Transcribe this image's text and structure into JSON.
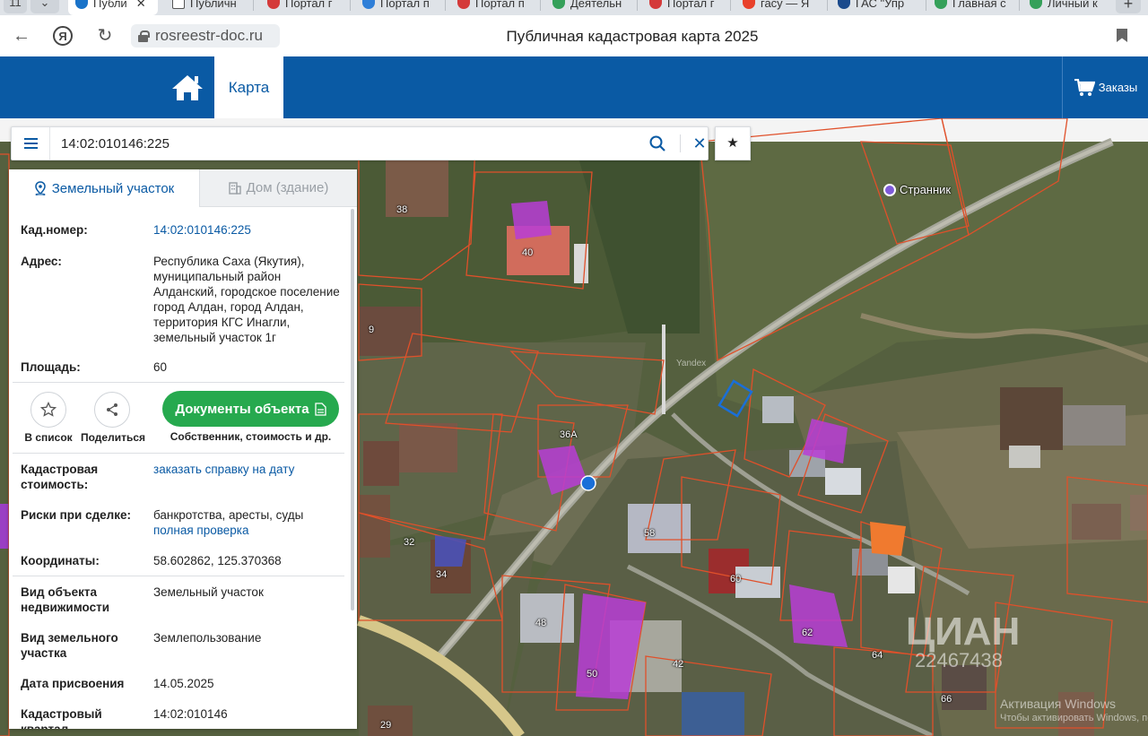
{
  "browser": {
    "tab_count_badge": "11",
    "tabs": [
      {
        "label": "Публи",
        "active": true,
        "color": "#1a73c9"
      },
      {
        "label": "Публичн",
        "color": "#555555"
      },
      {
        "label": "Портал г",
        "color": "#d43a3a"
      },
      {
        "label": "Портал п",
        "color": "#2f7fd8"
      },
      {
        "label": "Портал п",
        "color": "#d43a3a"
      },
      {
        "label": "Деятельн",
        "color": "#35a05a"
      },
      {
        "label": "Портал г",
        "color": "#d43a3a"
      },
      {
        "label": "гасу — Я",
        "color": "#e8412b"
      },
      {
        "label": "ГАС \"Упр",
        "color": "#1b4a8c"
      },
      {
        "label": "Главная с",
        "color": "#35a05a"
      },
      {
        "label": "Личный к",
        "color": "#35a05a"
      }
    ],
    "tab_close": "✕",
    "new_tab": "+",
    "url": "rosreestr-doc.ru",
    "page_title": "Публичная кадастровая карта 2025"
  },
  "header": {
    "map_tab": "Карта",
    "orders": "Заказы",
    "brand_color": "#0a5aa4"
  },
  "search": {
    "value": "14:02:010146:225",
    "clear": "✕",
    "favorite": "★"
  },
  "panel": {
    "tabs": [
      {
        "label": "Земельный участок",
        "active": true
      },
      {
        "label": "Дом (здание)",
        "active": false
      }
    ],
    "cad_number_label": "Кад.номер:",
    "cad_number_value": "14:02:010146:225",
    "address_label": "Адрес:",
    "address_value": "Республика Саха (Якутия), муниципальный район Алданский, городское поселение город Алдан, город Алдан, территория КГС Инагли, земельный участок 1г",
    "area_label": "Площадь:",
    "area_value": "60",
    "actions": {
      "to_list": "В список",
      "share": "Поделиться",
      "documents": "Документы объекта",
      "documents_sub": "Собственник, стоимость и др."
    },
    "cad_cost_label": "Кадастровая стоимость:",
    "cad_cost_value": "заказать справку на дату",
    "risks_label": "Риски при сделке:",
    "risks_value": "банкротства, аресты, суды",
    "risks_link": "полная проверка",
    "coords_label": "Координаты:",
    "coords_value": "58.602862, 125.370368",
    "object_type_label": "Вид объекта недвижимости",
    "object_type_value": "Земельный участок",
    "land_type_label": "Вид земельного участка",
    "land_type_value": "Землепользование",
    "assign_date_label": "Дата присвоения",
    "assign_date_value": "14.05.2025",
    "quarter_label": "Кадастровый квартал",
    "quarter_value": "14:02:010146",
    "accent_green": "#26a94e"
  },
  "map": {
    "poi": "Странник",
    "yandex": "Yandex",
    "house_numbers": [
      "38",
      "40",
      "9",
      "36А",
      "32",
      "34",
      "58",
      "60",
      "48",
      "50",
      "62",
      "64",
      "66",
      "29",
      "42"
    ],
    "watermark_brand": "ЦИАН",
    "watermark_id": "22467438",
    "activation_line1": "Активация Windows",
    "activation_line2": "Чтобы активировать Windows, перейдите в"
  }
}
